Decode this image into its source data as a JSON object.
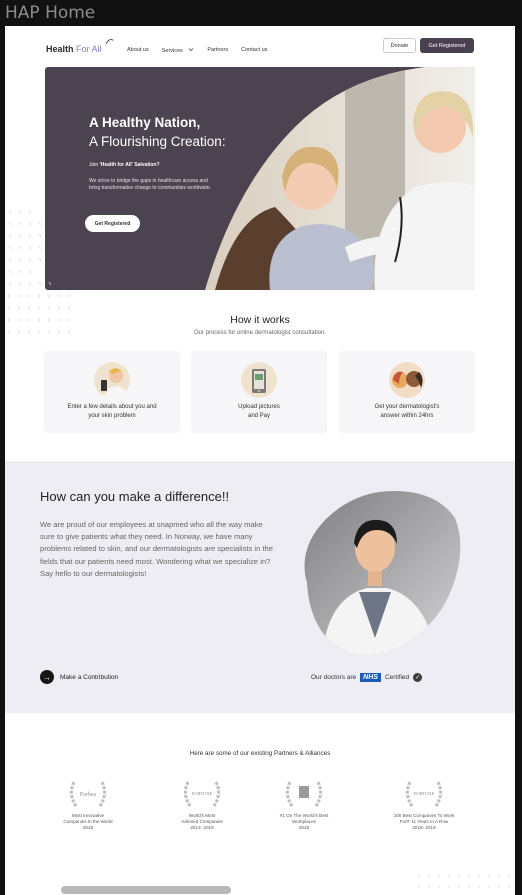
{
  "window": {
    "title": "HAP Home"
  },
  "header": {
    "logo_main": "Health",
    "logo_accent": "For All",
    "nav": [
      "About us",
      "Services",
      "Partners",
      "Contact us"
    ],
    "donate_label": "Donate",
    "register_label": "Get Registered"
  },
  "hero": {
    "title_bold": "A Healthy Nation,",
    "title_rest": "A Flourishing Creation:",
    "sub_prefix": "Join ",
    "sub_bold": "'Health for All' Salvation?",
    "description": "We strive to bridge the gaps in healthcare access and bring transformative change to communities worldwide.",
    "button_label": "Get Registered"
  },
  "how": {
    "title": "How it works",
    "subtitle": "Our process for online dermatologist consultation.",
    "steps": [
      {
        "line1": "Enter a few details about you and",
        "line2": "your skin problem"
      },
      {
        "line1": "Upload pictures",
        "line2": "and Pay"
      },
      {
        "line1": "Get your dermatologist's",
        "line2": "answer within 24hrs"
      }
    ]
  },
  "difference": {
    "title": "How can you make a difference!!",
    "text": "We are proud of our employees at snapmed who all the way make sure to give patients what they need. In Norway, we have many problems related to skin, and our dermatologists are specialists in the fields that our patients need most. Wondering what we specialize in? Say hello to our dermatologists!",
    "contribution_label": "Make a Contribution",
    "doctors_prefix": "Our doctors are",
    "nhs": "NHS",
    "certified": "Certified"
  },
  "partners": {
    "title": "Here are some of our existing Partners & Alliances",
    "awards": [
      {
        "logo": "Forbes",
        "line1": "Most Innovative",
        "line2": "Companies In the World",
        "line3": "2018"
      },
      {
        "logo": "FORTUNE",
        "line1": "World's Most",
        "line2": "Admired Companies",
        "line3": "2013- 2019"
      },
      {
        "logo": "",
        "line1": "#1 On The World's Best",
        "line2": "Workplaces",
        "line3": "2018"
      },
      {
        "logo": "FORTUNE",
        "line1": "100 Best Companies To Work",
        "line2": "For® 11 Years In A Row",
        "line3": "2018- 2019"
      }
    ]
  },
  "colors": {
    "brand_dark": "#4a4150",
    "accent": "#8a7fb0",
    "nhs_blue": "#1c5cb6",
    "section_bg": "#eeedf3"
  },
  "icons": [
    "logo-swoosh-icon",
    "chevron-down-icon",
    "arrow-right-icon",
    "check-icon",
    "laurel-icon"
  ]
}
